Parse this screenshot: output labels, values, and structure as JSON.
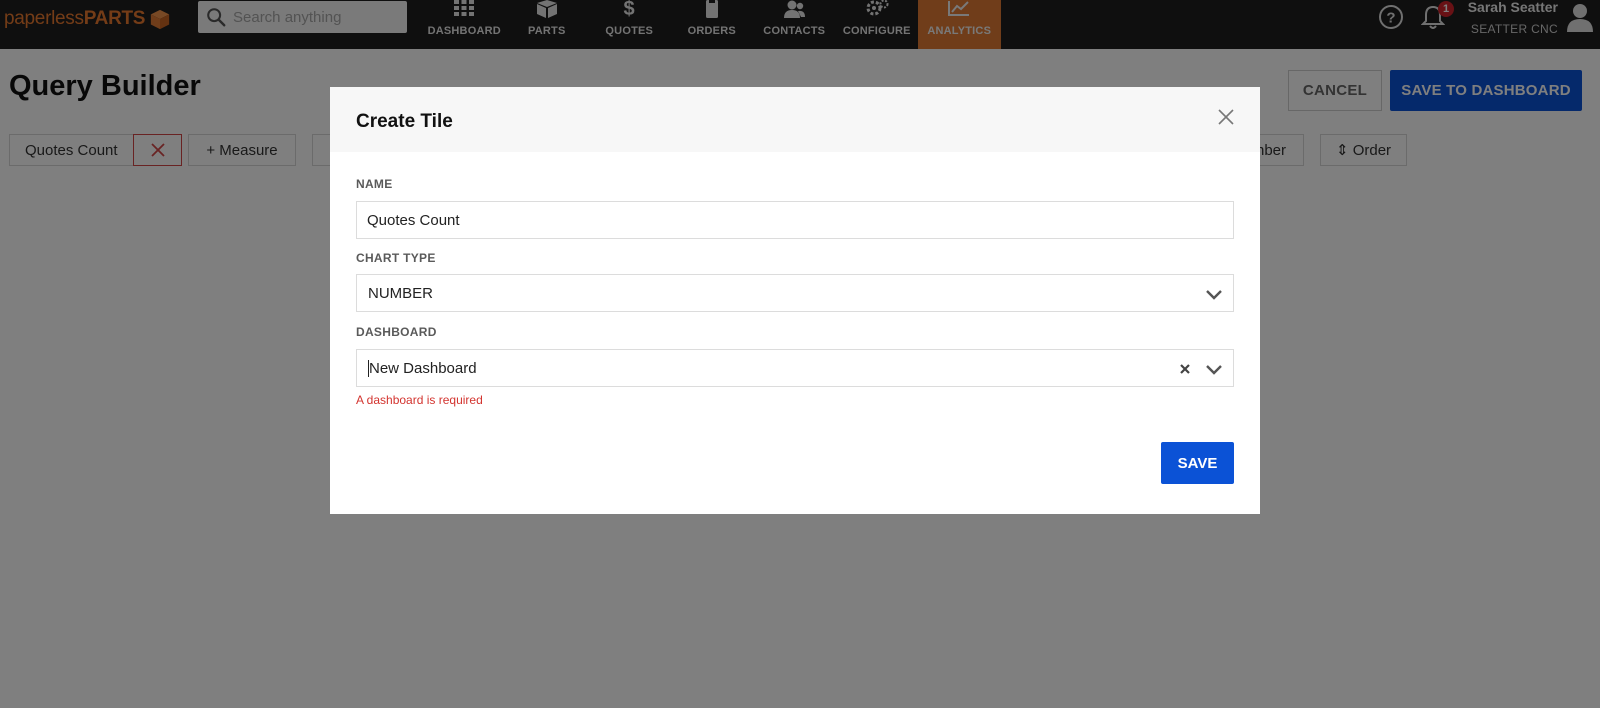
{
  "app": {
    "logo_light": "paperless",
    "logo_bold": "PARTS"
  },
  "search": {
    "placeholder": "Search anything"
  },
  "nav": {
    "items": [
      {
        "label": "DASHBOARD",
        "icon": "grid-icon"
      },
      {
        "label": "PARTS",
        "icon": "box-icon"
      },
      {
        "label": "QUOTES",
        "icon": "dollar-icon"
      },
      {
        "label": "ORDERS",
        "icon": "clipboard-icon"
      },
      {
        "label": "CONTACTS",
        "icon": "people-icon"
      },
      {
        "label": "CONFIGURE",
        "icon": "gears-icon"
      },
      {
        "label": "ANALYTICS",
        "icon": "chart-icon",
        "active": true
      }
    ]
  },
  "header": {
    "notification_count": "1",
    "user_name": "Sarah Seatter",
    "company": "SEATTER CNC"
  },
  "page": {
    "title": "Query Builder",
    "cancel_label": "CANCEL",
    "save_dashboard_label": "SAVE TO DASHBOARD",
    "chips": {
      "measure_value": "Quotes Count",
      "add_measure": "+ Measure",
      "number_partial": "nber",
      "order": "⇕ Order"
    }
  },
  "modal": {
    "title": "Create Tile",
    "name_label": "NAME",
    "name_value": "Quotes Count",
    "chart_type_label": "CHART TYPE",
    "chart_type_value": "NUMBER",
    "dashboard_label": "DASHBOARD",
    "dashboard_value": "New Dashboard",
    "error": "A dashboard is required",
    "save_label": "SAVE"
  },
  "colors": {
    "accent_orange": "#e07b34",
    "primary_blue": "#0b52d6",
    "error_red": "#d3342f",
    "nav_bg": "#1e1e1e"
  }
}
